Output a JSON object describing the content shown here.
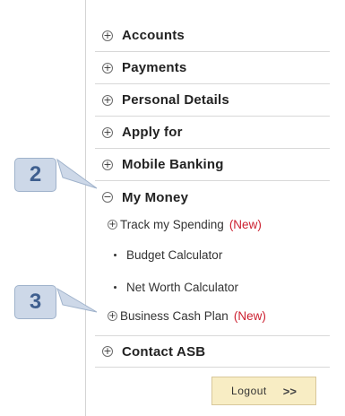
{
  "menu": {
    "items": [
      {
        "label": "Accounts",
        "icon": "+"
      },
      {
        "label": "Payments",
        "icon": "+"
      },
      {
        "label": "Personal Details",
        "icon": "+"
      },
      {
        "label": "Apply for",
        "icon": "+"
      },
      {
        "label": "Mobile Banking",
        "icon": "+"
      },
      {
        "label": "My Money",
        "icon": "−"
      },
      {
        "label": "Contact ASB",
        "icon": "+"
      }
    ],
    "sub_items": [
      {
        "label": "Track my Spending",
        "tag": "(New)",
        "icon": "+"
      },
      {
        "label": "Budget Calculator"
      },
      {
        "label": "Net Worth Calculator"
      },
      {
        "label": "Business Cash Plan",
        "tag": "(New)",
        "icon": "+"
      }
    ],
    "logout": {
      "label": "Logout",
      "arrows": ">>"
    }
  },
  "callouts": [
    "2",
    "3"
  ],
  "colors": {
    "new_tag": "#cc1f2f",
    "callout_fill": "#cdd8e8",
    "logout_bg": "#f8edc4"
  }
}
